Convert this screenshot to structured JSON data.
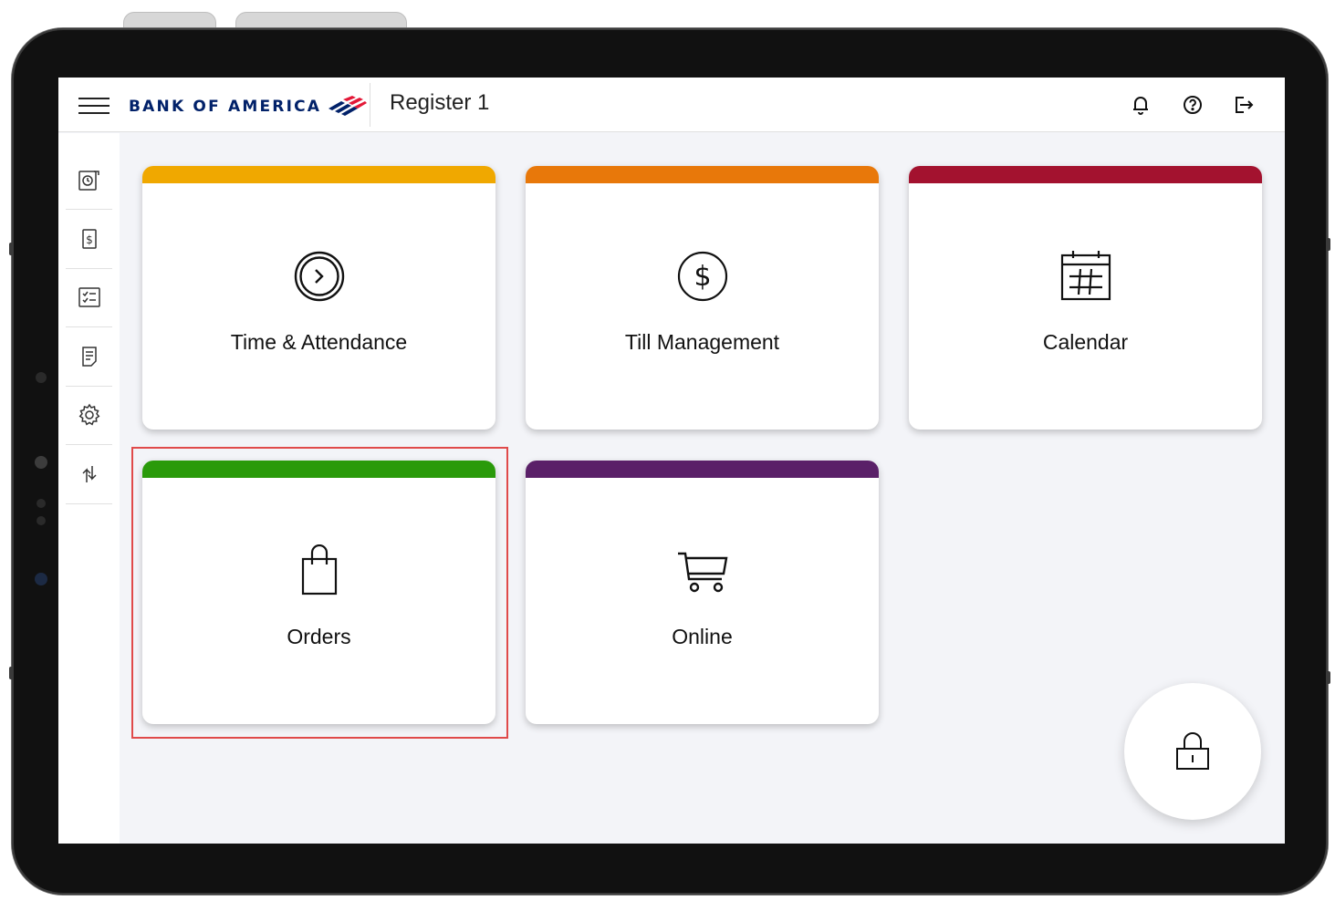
{
  "header": {
    "brand": "BANK OF AMERICA",
    "title": "Register 1",
    "colors": {
      "brand_blue": "#012169",
      "brand_red": "#e31837"
    },
    "actions": [
      {
        "name": "notifications",
        "icon": "bell-icon"
      },
      {
        "name": "help",
        "icon": "help-circle-icon"
      },
      {
        "name": "logout",
        "icon": "logout-icon"
      }
    ]
  },
  "sidebar": {
    "items": [
      {
        "icon": "clock-rotate-icon"
      },
      {
        "icon": "dollar-receipt-icon"
      },
      {
        "icon": "checklist-icon"
      },
      {
        "icon": "document-icon"
      },
      {
        "icon": "gear-icon"
      },
      {
        "icon": "sync-arrows-icon"
      }
    ],
    "status_icon": "status-check-icon"
  },
  "tiles": [
    {
      "label": "Time & Attendance",
      "color": "#f0a800",
      "icon": "clock-arrow-icon"
    },
    {
      "label": "Till Management",
      "color": "#e8780a",
      "icon": "dollar-circle-icon"
    },
    {
      "label": "Calendar",
      "color": "#a3122f",
      "icon": "calendar-icon"
    },
    {
      "label": "Orders",
      "color": "#2a9a0a",
      "icon": "shopping-bag-icon"
    },
    {
      "label": "Online",
      "color": "#5a2068",
      "icon": "shopping-cart-icon"
    }
  ],
  "lock_button": {
    "icon": "lock-icon"
  }
}
